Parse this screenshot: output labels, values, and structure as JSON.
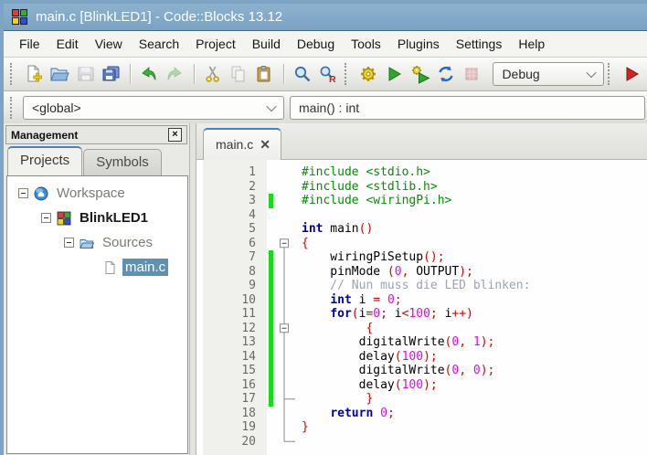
{
  "window": {
    "title": "main.c [BlinkLED1] - Code::Blocks 13.12"
  },
  "menu": {
    "items": [
      "File",
      "Edit",
      "View",
      "Search",
      "Project",
      "Build",
      "Debug",
      "Tools",
      "Plugins",
      "Settings",
      "Help"
    ]
  },
  "toolbar": {
    "buttons": [
      {
        "name": "new-file-button",
        "icon": "new-file-icon",
        "disabled": false
      },
      {
        "name": "open-file-button",
        "icon": "open-folder-icon",
        "disabled": false
      },
      {
        "name": "save-button",
        "icon": "save-icon",
        "disabled": true
      },
      {
        "name": "save-all-button",
        "icon": "save-all-icon",
        "disabled": false
      },
      {
        "sep": true
      },
      {
        "name": "undo-button",
        "icon": "undo-icon",
        "disabled": false
      },
      {
        "name": "redo-button",
        "icon": "redo-icon",
        "disabled": true
      },
      {
        "sep": true
      },
      {
        "name": "cut-button",
        "icon": "cut-icon",
        "disabled": false
      },
      {
        "name": "copy-button",
        "icon": "copy-icon",
        "disabled": true
      },
      {
        "name": "paste-button",
        "icon": "paste-icon",
        "disabled": false
      },
      {
        "sep": true
      },
      {
        "name": "find-button",
        "icon": "find-icon",
        "disabled": false
      },
      {
        "name": "replace-button",
        "icon": "replace-icon",
        "disabled": false
      },
      {
        "grip": true
      },
      {
        "name": "build-button",
        "icon": "build-icon",
        "disabled": false
      },
      {
        "name": "run-button",
        "icon": "run-icon",
        "disabled": false
      },
      {
        "name": "build-run-button",
        "icon": "build-run-icon",
        "disabled": false
      },
      {
        "name": "rebuild-button",
        "icon": "rebuild-icon",
        "disabled": false
      },
      {
        "name": "abort-button",
        "icon": "abort-icon",
        "disabled": true
      },
      {
        "combo": true
      },
      {
        "grip": true
      },
      {
        "name": "debug-continue-button",
        "icon": "debug-run-icon",
        "disabled": false
      }
    ],
    "build_target_value": "Debug"
  },
  "scope_bar": {
    "scope_value": "<global>",
    "function_value": "main() : int"
  },
  "management": {
    "title": "Management",
    "close_glyph": "×",
    "tabs": [
      {
        "label": "Projects",
        "active": true
      },
      {
        "label": "Symbols",
        "active": false
      }
    ],
    "tree": [
      {
        "label": "Workspace",
        "icon": "workspace-icon",
        "level": 0,
        "expander": true,
        "bold": false,
        "selected": false
      },
      {
        "label": "BlinkLED1",
        "icon": "project-icon",
        "level": 1,
        "expander": true,
        "bold": true,
        "selected": false
      },
      {
        "label": "Sources",
        "icon": "folder-icon",
        "level": 2,
        "expander": true,
        "bold": false,
        "selected": false
      },
      {
        "label": "main.c",
        "icon": "file-icon",
        "level": 3,
        "expander": false,
        "bold": false,
        "selected": true
      }
    ]
  },
  "editor": {
    "tab_label": "main.c",
    "tab_close_glyph": "✕",
    "fold": {
      "boxes": [
        6,
        12
      ],
      "ticks": [
        17
      ],
      "corner": 20,
      "line_start": 6,
      "line_end": 20
    },
    "changed_lines": [
      3,
      7,
      8,
      9,
      10,
      11,
      12,
      13,
      14,
      15,
      16,
      17
    ],
    "lines": [
      {
        "n": 1,
        "t": [
          [
            "p",
            "#include <stdio.h>"
          ]
        ]
      },
      {
        "n": 2,
        "t": [
          [
            "p",
            "#include <stdlib.h>"
          ]
        ]
      },
      {
        "n": 3,
        "t": [
          [
            "p",
            "#include <wiringPi.h>"
          ]
        ]
      },
      {
        "n": 4,
        "t": []
      },
      {
        "n": 5,
        "t": [
          [
            "k",
            "int"
          ],
          [
            "i",
            " main"
          ],
          [
            "o",
            "()"
          ]
        ]
      },
      {
        "n": 6,
        "t": [
          [
            "o",
            "{"
          ]
        ]
      },
      {
        "n": 7,
        "t": [
          [
            "i",
            "    wiringPiSetup"
          ],
          [
            "o",
            "();"
          ]
        ]
      },
      {
        "n": 8,
        "t": [
          [
            "i",
            "    pinMode "
          ],
          [
            "o",
            "("
          ],
          [
            "n",
            "0"
          ],
          [
            "o",
            ", "
          ],
          [
            "i",
            "OUTPUT"
          ],
          [
            "o",
            ");"
          ]
        ]
      },
      {
        "n": 9,
        "t": [
          [
            "c",
            "    // Nun muss die LED blinken:"
          ]
        ]
      },
      {
        "n": 10,
        "t": [
          [
            "i",
            "    "
          ],
          [
            "k",
            "int"
          ],
          [
            "i",
            " i "
          ],
          [
            "o",
            "= "
          ],
          [
            "n",
            "0"
          ],
          [
            "o",
            ";"
          ]
        ]
      },
      {
        "n": 11,
        "t": [
          [
            "i",
            "    "
          ],
          [
            "k",
            "for"
          ],
          [
            "o",
            "("
          ],
          [
            "i",
            "i"
          ],
          [
            "o",
            "="
          ],
          [
            "n",
            "0"
          ],
          [
            "o",
            "; "
          ],
          [
            "i",
            "i"
          ],
          [
            "o",
            "<"
          ],
          [
            "n",
            "100"
          ],
          [
            "o",
            "; "
          ],
          [
            "i",
            "i"
          ],
          [
            "o",
            "++)"
          ]
        ]
      },
      {
        "n": 12,
        "t": [
          [
            "o",
            "         {"
          ]
        ]
      },
      {
        "n": 13,
        "t": [
          [
            "i",
            "        digitalWrite"
          ],
          [
            "o",
            "("
          ],
          [
            "n",
            "0"
          ],
          [
            "o",
            ", "
          ],
          [
            "n",
            "1"
          ],
          [
            "o",
            ");"
          ]
        ]
      },
      {
        "n": 14,
        "t": [
          [
            "i",
            "        delay"
          ],
          [
            "o",
            "("
          ],
          [
            "n",
            "100"
          ],
          [
            "o",
            ");"
          ]
        ]
      },
      {
        "n": 15,
        "t": [
          [
            "i",
            "        digitalWrite"
          ],
          [
            "o",
            "("
          ],
          [
            "n",
            "0"
          ],
          [
            "o",
            ", "
          ],
          [
            "n",
            "0"
          ],
          [
            "o",
            ");"
          ]
        ]
      },
      {
        "n": 16,
        "t": [
          [
            "i",
            "        delay"
          ],
          [
            "o",
            "("
          ],
          [
            "n",
            "100"
          ],
          [
            "o",
            ");"
          ]
        ]
      },
      {
        "n": 17,
        "t": [
          [
            "o",
            "         }"
          ]
        ]
      },
      {
        "n": 18,
        "t": [
          [
            "i",
            "    "
          ],
          [
            "k",
            "return"
          ],
          [
            "i",
            " "
          ],
          [
            "n",
            "0"
          ],
          [
            "o",
            ";"
          ]
        ]
      },
      {
        "n": 19,
        "t": [
          [
            "o",
            "}"
          ]
        ]
      },
      {
        "n": 20,
        "t": []
      }
    ]
  },
  "colors": {
    "titlebar": "#7da4c5",
    "accent_tab": "#4a80c0",
    "selection": "#6191b2",
    "change_bar": "#14dd14",
    "syntax": {
      "preprocessor": "#009100",
      "keyword": "#0000a8",
      "identifier": "#000000",
      "number": "#f000f0",
      "operator": "#dd0000",
      "comment": "#9ca4b6"
    }
  }
}
